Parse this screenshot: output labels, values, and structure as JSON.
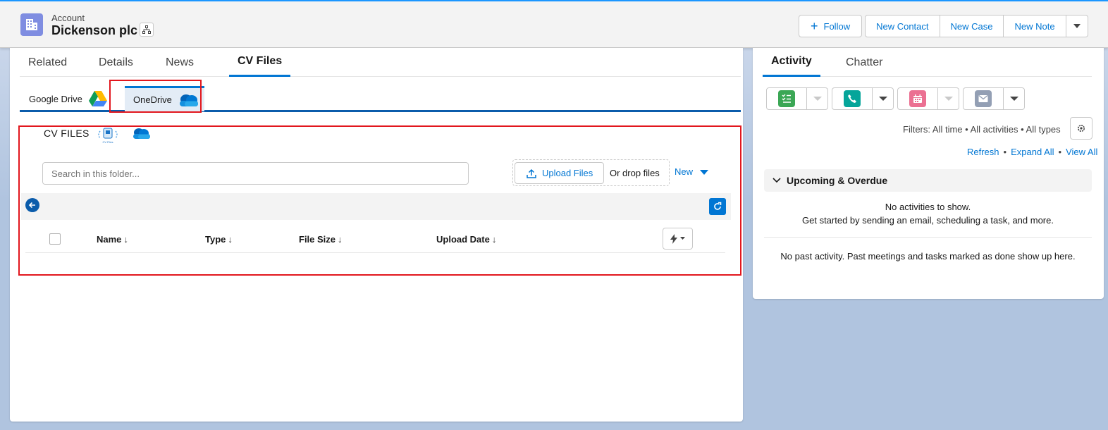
{
  "header": {
    "object_label": "Account",
    "record_name": "Dickenson plc",
    "actions": {
      "follow": "Follow",
      "new_contact": "New Contact",
      "new_case": "New Case",
      "new_note": "New Note"
    }
  },
  "main": {
    "tabs": [
      "Related",
      "Details",
      "News",
      "CV Files"
    ],
    "active_tab": "CV Files",
    "sub_tabs": {
      "google_drive": "Google Drive",
      "onedrive": "OneDrive"
    },
    "cv_files": {
      "title": "CV FILES",
      "search_placeholder": "Search in this folder...",
      "upload_label": "Upload Files",
      "drop_text": "Or drop files",
      "new_label": "New",
      "columns": [
        "Name",
        "Type",
        "File Size",
        "Upload Date"
      ]
    }
  },
  "activity": {
    "tabs": [
      "Activity",
      "Chatter"
    ],
    "filters": "Filters: All time • All activities • All types",
    "links": {
      "refresh": "Refresh",
      "expand_all": "Expand All",
      "view_all": "View All",
      "sep": "•"
    },
    "upcoming_title": "Upcoming & Overdue",
    "no_activities": "No activities to show.",
    "get_started": "Get started by sending an email, scheduling a task, and more.",
    "no_past": "No past activity. Past meetings and tasks marked as done show up here.",
    "publishers": [
      {
        "icon": "task-icon",
        "color": "#3ba755"
      },
      {
        "icon": "call-icon",
        "color": "#06a59a"
      },
      {
        "icon": "event-icon",
        "color": "#cb65ff"
      },
      {
        "icon": "email-icon",
        "color": "#939393"
      }
    ]
  },
  "colors": {
    "brand": "#0176d3",
    "highlight": "#e2161d",
    "account_icon": "#7f8de1"
  }
}
